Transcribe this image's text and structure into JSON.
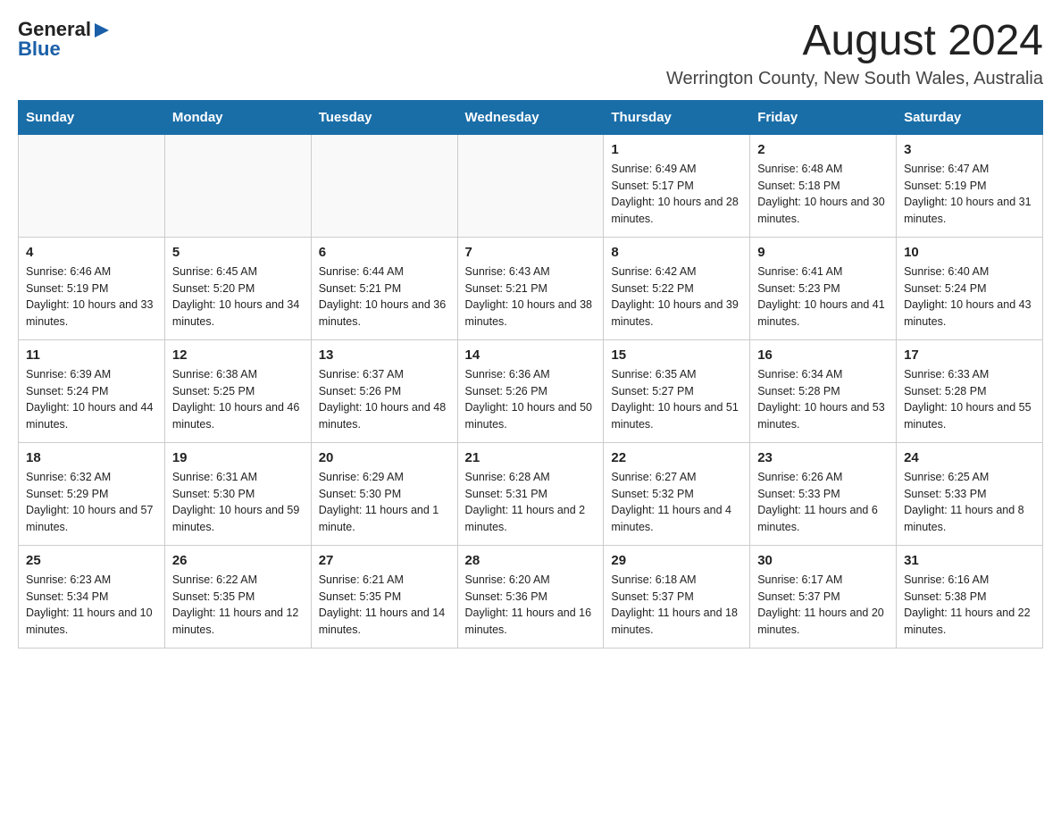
{
  "header": {
    "logo_general": "General",
    "logo_blue": "Blue",
    "month_title": "August 2024",
    "subtitle": "Werrington County, New South Wales, Australia"
  },
  "weekdays": [
    "Sunday",
    "Monday",
    "Tuesday",
    "Wednesday",
    "Thursday",
    "Friday",
    "Saturday"
  ],
  "weeks": [
    [
      {
        "day": "",
        "info": ""
      },
      {
        "day": "",
        "info": ""
      },
      {
        "day": "",
        "info": ""
      },
      {
        "day": "",
        "info": ""
      },
      {
        "day": "1",
        "info": "Sunrise: 6:49 AM\nSunset: 5:17 PM\nDaylight: 10 hours and 28 minutes."
      },
      {
        "day": "2",
        "info": "Sunrise: 6:48 AM\nSunset: 5:18 PM\nDaylight: 10 hours and 30 minutes."
      },
      {
        "day": "3",
        "info": "Sunrise: 6:47 AM\nSunset: 5:19 PM\nDaylight: 10 hours and 31 minutes."
      }
    ],
    [
      {
        "day": "4",
        "info": "Sunrise: 6:46 AM\nSunset: 5:19 PM\nDaylight: 10 hours and 33 minutes."
      },
      {
        "day": "5",
        "info": "Sunrise: 6:45 AM\nSunset: 5:20 PM\nDaylight: 10 hours and 34 minutes."
      },
      {
        "day": "6",
        "info": "Sunrise: 6:44 AM\nSunset: 5:21 PM\nDaylight: 10 hours and 36 minutes."
      },
      {
        "day": "7",
        "info": "Sunrise: 6:43 AM\nSunset: 5:21 PM\nDaylight: 10 hours and 38 minutes."
      },
      {
        "day": "8",
        "info": "Sunrise: 6:42 AM\nSunset: 5:22 PM\nDaylight: 10 hours and 39 minutes."
      },
      {
        "day": "9",
        "info": "Sunrise: 6:41 AM\nSunset: 5:23 PM\nDaylight: 10 hours and 41 minutes."
      },
      {
        "day": "10",
        "info": "Sunrise: 6:40 AM\nSunset: 5:24 PM\nDaylight: 10 hours and 43 minutes."
      }
    ],
    [
      {
        "day": "11",
        "info": "Sunrise: 6:39 AM\nSunset: 5:24 PM\nDaylight: 10 hours and 44 minutes."
      },
      {
        "day": "12",
        "info": "Sunrise: 6:38 AM\nSunset: 5:25 PM\nDaylight: 10 hours and 46 minutes."
      },
      {
        "day": "13",
        "info": "Sunrise: 6:37 AM\nSunset: 5:26 PM\nDaylight: 10 hours and 48 minutes."
      },
      {
        "day": "14",
        "info": "Sunrise: 6:36 AM\nSunset: 5:26 PM\nDaylight: 10 hours and 50 minutes."
      },
      {
        "day": "15",
        "info": "Sunrise: 6:35 AM\nSunset: 5:27 PM\nDaylight: 10 hours and 51 minutes."
      },
      {
        "day": "16",
        "info": "Sunrise: 6:34 AM\nSunset: 5:28 PM\nDaylight: 10 hours and 53 minutes."
      },
      {
        "day": "17",
        "info": "Sunrise: 6:33 AM\nSunset: 5:28 PM\nDaylight: 10 hours and 55 minutes."
      }
    ],
    [
      {
        "day": "18",
        "info": "Sunrise: 6:32 AM\nSunset: 5:29 PM\nDaylight: 10 hours and 57 minutes."
      },
      {
        "day": "19",
        "info": "Sunrise: 6:31 AM\nSunset: 5:30 PM\nDaylight: 10 hours and 59 minutes."
      },
      {
        "day": "20",
        "info": "Sunrise: 6:29 AM\nSunset: 5:30 PM\nDaylight: 11 hours and 1 minute."
      },
      {
        "day": "21",
        "info": "Sunrise: 6:28 AM\nSunset: 5:31 PM\nDaylight: 11 hours and 2 minutes."
      },
      {
        "day": "22",
        "info": "Sunrise: 6:27 AM\nSunset: 5:32 PM\nDaylight: 11 hours and 4 minutes."
      },
      {
        "day": "23",
        "info": "Sunrise: 6:26 AM\nSunset: 5:33 PM\nDaylight: 11 hours and 6 minutes."
      },
      {
        "day": "24",
        "info": "Sunrise: 6:25 AM\nSunset: 5:33 PM\nDaylight: 11 hours and 8 minutes."
      }
    ],
    [
      {
        "day": "25",
        "info": "Sunrise: 6:23 AM\nSunset: 5:34 PM\nDaylight: 11 hours and 10 minutes."
      },
      {
        "day": "26",
        "info": "Sunrise: 6:22 AM\nSunset: 5:35 PM\nDaylight: 11 hours and 12 minutes."
      },
      {
        "day": "27",
        "info": "Sunrise: 6:21 AM\nSunset: 5:35 PM\nDaylight: 11 hours and 14 minutes."
      },
      {
        "day": "28",
        "info": "Sunrise: 6:20 AM\nSunset: 5:36 PM\nDaylight: 11 hours and 16 minutes."
      },
      {
        "day": "29",
        "info": "Sunrise: 6:18 AM\nSunset: 5:37 PM\nDaylight: 11 hours and 18 minutes."
      },
      {
        "day": "30",
        "info": "Sunrise: 6:17 AM\nSunset: 5:37 PM\nDaylight: 11 hours and 20 minutes."
      },
      {
        "day": "31",
        "info": "Sunrise: 6:16 AM\nSunset: 5:38 PM\nDaylight: 11 hours and 22 minutes."
      }
    ]
  ]
}
